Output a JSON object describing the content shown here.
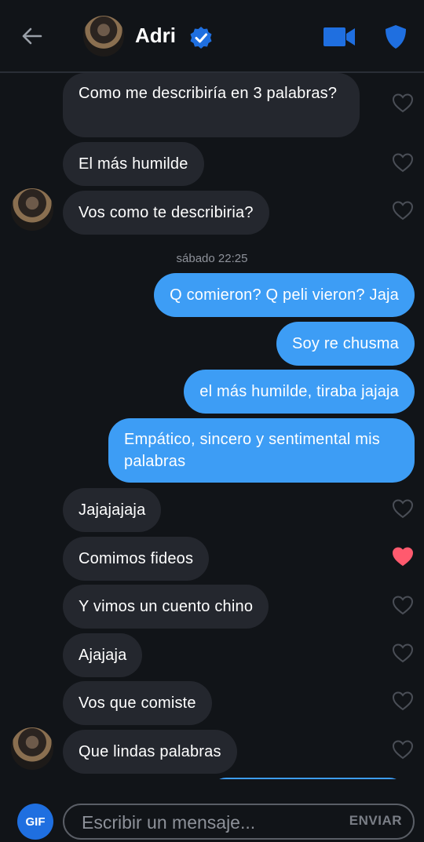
{
  "header": {
    "contact_name": "Adri",
    "icons": {
      "back": "back-arrow-icon",
      "verified": "verified-badge-icon",
      "video": "video-camera-icon",
      "safety": "shield-icon"
    },
    "accent_color": "#1f6fe0"
  },
  "chat": {
    "timestamp": "sábado 22:25",
    "messages": [
      {
        "side": "in",
        "text": "Como me describiría en 3 palabras?",
        "liked": false
      },
      {
        "side": "in",
        "text": "El más humilde",
        "liked": false
      },
      {
        "side": "in",
        "text": "Vos como te describiria?",
        "liked": false
      },
      {
        "side": "out",
        "text": "Q comieron? Q peli vieron? Jaja"
      },
      {
        "side": "out",
        "text": "Soy re chusma"
      },
      {
        "side": "out",
        "text": "el más humilde, tiraba jajaja"
      },
      {
        "side": "out",
        "text": "Empático, sincero y sentimental mis palabras"
      },
      {
        "side": "in",
        "text": "Jajajajaja",
        "liked": false
      },
      {
        "side": "in",
        "text": "Comimos fideos",
        "liked": true
      },
      {
        "side": "in",
        "text": "Y vimos un cuento chino",
        "liked": false
      },
      {
        "side": "in",
        "text": "Ajajaja",
        "liked": false
      },
      {
        "side": "in",
        "text": "Vos que comiste",
        "liked": false
      },
      {
        "side": "in",
        "text": "Que lindas palabras",
        "liked": false
      }
    ],
    "colors": {
      "incoming": "#24272e",
      "outgoing": "#3d9df5",
      "heart_liked": "#ff5a6e"
    }
  },
  "composer": {
    "gif_label": "GIF",
    "placeholder": "Escribir un mensaje...",
    "send_label": "ENVIAR"
  }
}
